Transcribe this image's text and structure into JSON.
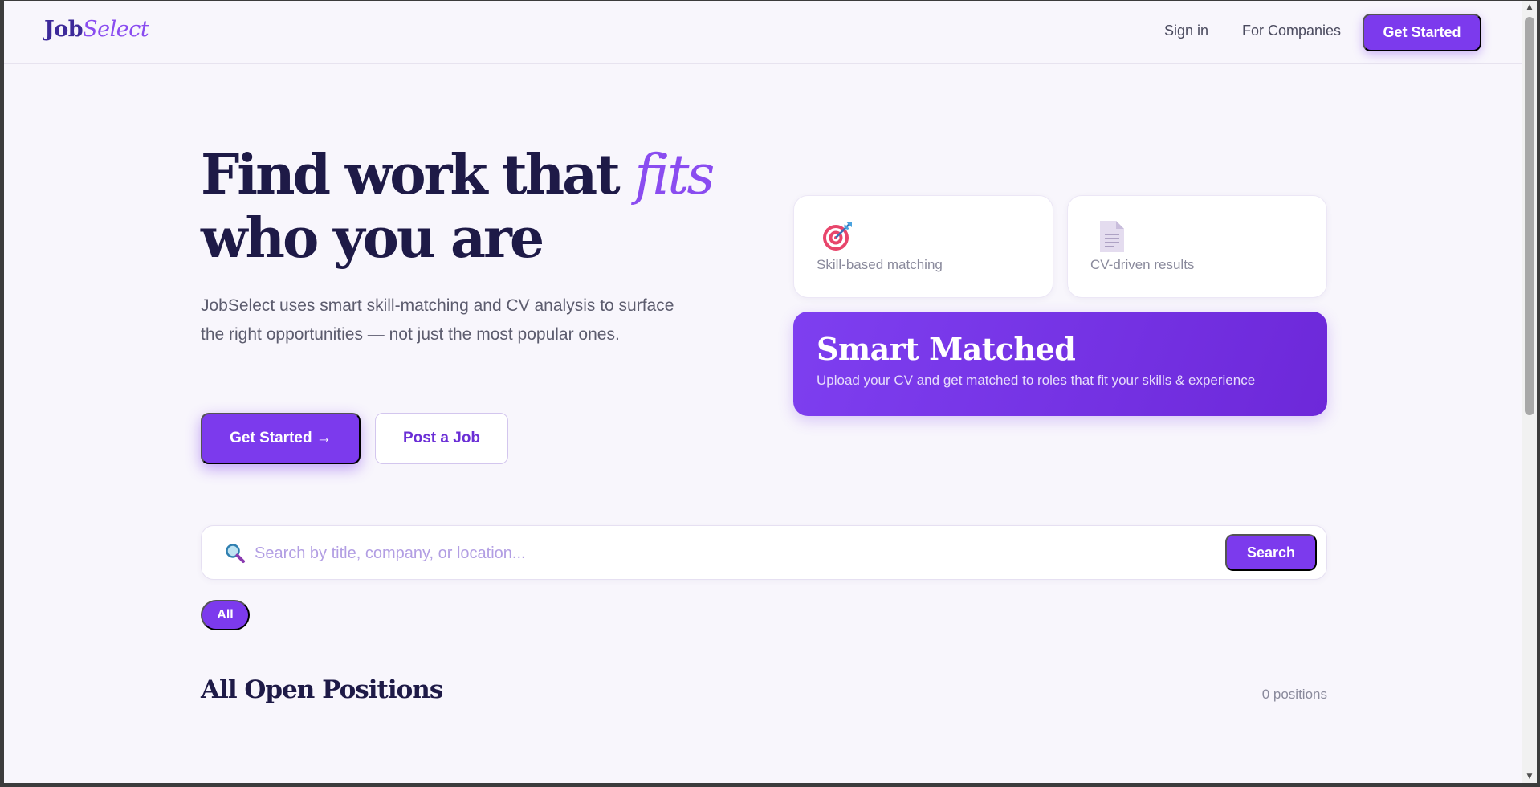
{
  "nav": {
    "logo_primary": "Job",
    "logo_accent": "Select",
    "sign_in": "Sign in",
    "for_companies": "For Companies",
    "cta": "Get Started"
  },
  "hero": {
    "title_line1": "Find work that ",
    "title_accent": "fits",
    "title_line2": "who you are",
    "subtitle": "JobSelect uses smart skill-matching and CV analysis to surface the right opportunities — not just the most popular ones.",
    "primary_button": "Get Started →",
    "secondary_button": "Post a Job"
  },
  "features": [
    {
      "label": "Skill-based matching",
      "icon": "target-icon"
    },
    {
      "label": "CV-driven results",
      "icon": "document-icon"
    }
  ],
  "smart_card": {
    "title": "Smart Matched",
    "subtitle": "Upload your CV and get matched to roles that fit your skills & experience"
  },
  "search": {
    "placeholder": "Search by title, company, or location...",
    "value": "",
    "button": "Search",
    "icon": "magnifier-icon"
  },
  "filters": {
    "chips": [
      "All"
    ],
    "active": "All"
  },
  "listing": {
    "title": "All Open Positions",
    "count": "0 positions"
  },
  "colors": {
    "brand": "#7c3aed",
    "heading": "#1e1a47",
    "accent": "#8a4cf0",
    "background": "#f8f6fc"
  }
}
